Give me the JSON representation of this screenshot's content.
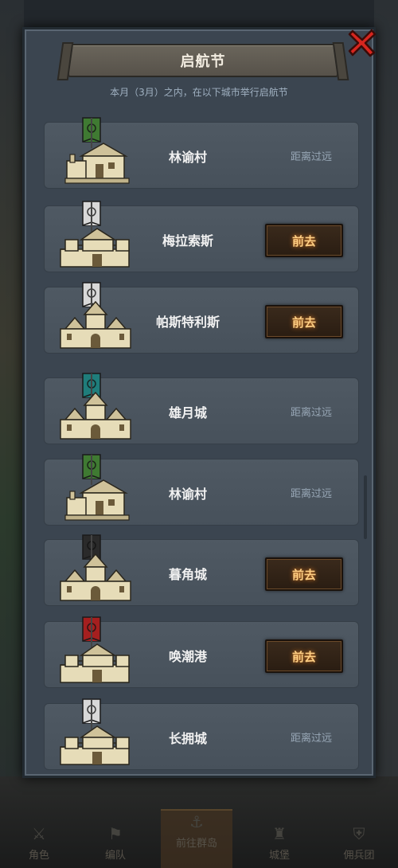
{
  "dialog": {
    "title": "启航节",
    "subtitle": "本月（3月）之内，在以下城市举行启航节",
    "close_icon": "close-icon"
  },
  "rows": [
    {
      "name": "林谕村",
      "action": "距离过远",
      "actionable": false,
      "banner_color": "#3f7a32",
      "castle": "village"
    },
    {
      "name": "梅拉索斯",
      "action": "前去",
      "actionable": true,
      "banner_color": "#d8d8d8",
      "castle": "fort"
    },
    {
      "name": "帕斯特利斯",
      "action": "前去",
      "actionable": true,
      "banner_color": "#d8d8d8",
      "castle": "palace"
    },
    {
      "name": "雄月城",
      "action": "距离过远",
      "actionable": false,
      "banner_color": "#1f7d7b",
      "castle": "palace"
    },
    {
      "name": "林谕村",
      "action": "距离过远",
      "actionable": false,
      "banner_color": "#3f7a32",
      "castle": "village"
    },
    {
      "name": "暮角城",
      "action": "前去",
      "actionable": true,
      "banner_color": "#2a2a2a",
      "castle": "palace"
    },
    {
      "name": "唤潮港",
      "action": "前去",
      "actionable": true,
      "banner_color": "#a51f1f",
      "castle": "fort"
    },
    {
      "name": "长拥城",
      "action": "距离过远",
      "actionable": false,
      "banner_color": "#d8d8d8",
      "castle": "fort"
    }
  ],
  "bottom_nav": [
    {
      "label": "角色",
      "icon": "character-icon"
    },
    {
      "label": "编队",
      "icon": "squad-icon"
    },
    {
      "label": "前往群岛",
      "icon": "island-icon",
      "active": true
    },
    {
      "label": "城堡",
      "icon": "castle-icon"
    },
    {
      "label": "佣兵团",
      "icon": "mercenary-icon"
    }
  ]
}
